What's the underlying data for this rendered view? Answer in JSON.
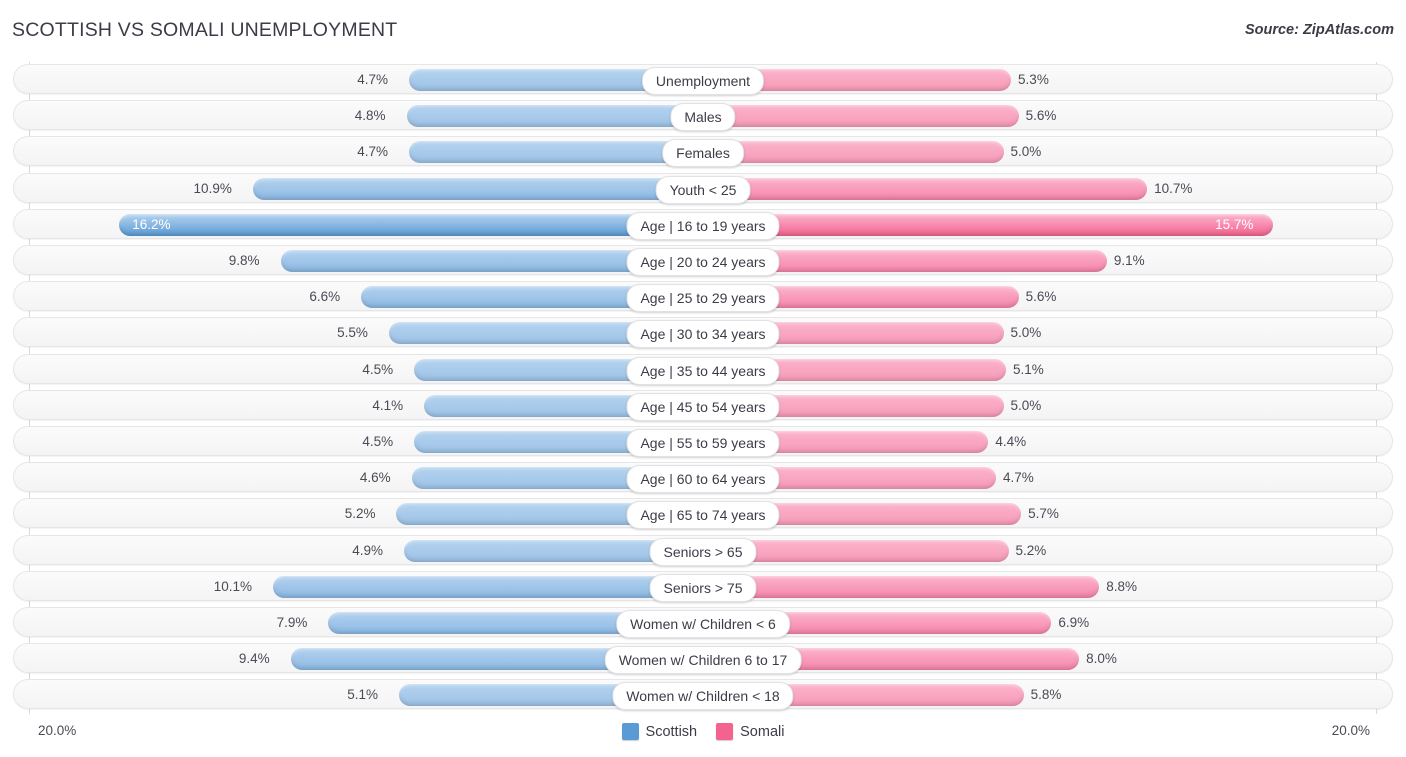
{
  "header": {
    "title": "SCOTTISH VS SOMALI UNEMPLOYMENT",
    "source": "Source: ZipAtlas.com"
  },
  "footer": {
    "axis_max_left": "20.0%",
    "axis_max_right": "20.0%",
    "legend": [
      {
        "label": "Scottish",
        "color": "#5b9bd5"
      },
      {
        "label": "Somali",
        "color": "#f4628f"
      }
    ]
  },
  "colors": {
    "scottish_light": "#9dc3e8",
    "scottish_mid": "#8cb9e4",
    "scottish_dark": "#5b9bd5",
    "somali_light": "#f79ab8",
    "somali_mid": "#f685ab",
    "somali_dark": "#f4628f",
    "row_background": "#f7f7f8",
    "text": "#3c3c48"
  },
  "chart_data": {
    "type": "bar",
    "orientation": "horizontal-diverging",
    "title": "SCOTTISH VS SOMALI UNEMPLOYMENT",
    "subtitle": "Source: ZipAtlas.com",
    "xlabel": "",
    "ylabel": "",
    "xlim": [
      20.0,
      20.0
    ],
    "axis_max_label": "20.0%",
    "grid": false,
    "legend_position": "bottom-center",
    "categories": [
      "Unemployment",
      "Males",
      "Females",
      "Youth < 25",
      "Age | 16 to 19 years",
      "Age | 20 to 24 years",
      "Age | 25 to 29 years",
      "Age | 30 to 34 years",
      "Age | 35 to 44 years",
      "Age | 45 to 54 years",
      "Age | 55 to 59 years",
      "Age | 60 to 64 years",
      "Age | 65 to 74 years",
      "Seniors > 65",
      "Seniors > 75",
      "Women w/ Children < 6",
      "Women w/ Children 6 to 17",
      "Women w/ Children < 18"
    ],
    "series": [
      {
        "name": "Scottish",
        "side": "left",
        "color": "#5b9bd5",
        "values": [
          4.7,
          4.8,
          4.7,
          10.9,
          16.2,
          9.8,
          6.6,
          5.5,
          4.5,
          4.1,
          4.5,
          4.6,
          5.2,
          4.9,
          10.1,
          7.9,
          9.4,
          5.1
        ],
        "labels": [
          "4.7%",
          "4.8%",
          "4.7%",
          "10.9%",
          "16.2%",
          "9.8%",
          "6.6%",
          "5.5%",
          "4.5%",
          "4.1%",
          "4.5%",
          "4.6%",
          "5.2%",
          "4.9%",
          "10.1%",
          "7.9%",
          "9.4%",
          "5.1%"
        ]
      },
      {
        "name": "Somali",
        "side": "right",
        "color": "#f4628f",
        "values": [
          5.3,
          5.6,
          5.0,
          10.7,
          15.7,
          9.1,
          5.6,
          5.0,
          5.1,
          5.0,
          4.4,
          4.7,
          5.7,
          5.2,
          8.8,
          6.9,
          8.0,
          5.8
        ],
        "labels": [
          "5.3%",
          "5.6%",
          "5.0%",
          "10.7%",
          "15.7%",
          "9.1%",
          "5.6%",
          "5.0%",
          "5.1%",
          "5.0%",
          "4.4%",
          "4.7%",
          "5.7%",
          "5.2%",
          "8.8%",
          "6.9%",
          "8.0%",
          "5.8%"
        ]
      }
    ]
  },
  "rows": [
    {
      "label": "Unemployment",
      "left": "4.7%",
      "right": "5.3%",
      "lv": 4.7,
      "rv": 5.3,
      "intensity": 0
    },
    {
      "label": "Males",
      "left": "4.8%",
      "right": "5.6%",
      "lv": 4.8,
      "rv": 5.6,
      "intensity": 0
    },
    {
      "label": "Females",
      "left": "4.7%",
      "right": "5.0%",
      "lv": 4.7,
      "rv": 5.0,
      "intensity": 0
    },
    {
      "label": "Youth < 25",
      "left": "10.9%",
      "right": "10.7%",
      "lv": 10.9,
      "rv": 10.7,
      "intensity": 1
    },
    {
      "label": "Age | 16 to 19 years",
      "left": "16.2%",
      "right": "15.7%",
      "lv": 16.2,
      "rv": 15.7,
      "intensity": 2
    },
    {
      "label": "Age | 20 to 24 years",
      "left": "9.8%",
      "right": "9.1%",
      "lv": 9.8,
      "rv": 9.1,
      "intensity": 1
    },
    {
      "label": "Age | 25 to 29 years",
      "left": "6.6%",
      "right": "5.6%",
      "lv": 6.6,
      "rv": 5.6,
      "intensity": 1
    },
    {
      "label": "Age | 30 to 34 years",
      "left": "5.5%",
      "right": "5.0%",
      "lv": 5.5,
      "rv": 5.0,
      "intensity": 0
    },
    {
      "label": "Age | 35 to 44 years",
      "left": "4.5%",
      "right": "5.1%",
      "lv": 4.5,
      "rv": 5.1,
      "intensity": 0
    },
    {
      "label": "Age | 45 to 54 years",
      "left": "4.1%",
      "right": "5.0%",
      "lv": 4.1,
      "rv": 5.0,
      "intensity": 0
    },
    {
      "label": "Age | 55 to 59 years",
      "left": "4.5%",
      "right": "4.4%",
      "lv": 4.5,
      "rv": 4.4,
      "intensity": 0
    },
    {
      "label": "Age | 60 to 64 years",
      "left": "4.6%",
      "right": "4.7%",
      "lv": 4.6,
      "rv": 4.7,
      "intensity": 0
    },
    {
      "label": "Age | 65 to 74 years",
      "left": "5.2%",
      "right": "5.7%",
      "lv": 5.2,
      "rv": 5.7,
      "intensity": 0
    },
    {
      "label": "Seniors > 65",
      "left": "4.9%",
      "right": "5.2%",
      "lv": 4.9,
      "rv": 5.2,
      "intensity": 0
    },
    {
      "label": "Seniors > 75",
      "left": "10.1%",
      "right": "8.8%",
      "lv": 10.1,
      "rv": 8.8,
      "intensity": 1
    },
    {
      "label": "Women w/ Children < 6",
      "left": "7.9%",
      "right": "6.9%",
      "lv": 7.9,
      "rv": 6.9,
      "intensity": 1
    },
    {
      "label": "Women w/ Children 6 to 17",
      "left": "9.4%",
      "right": "8.0%",
      "lv": 9.4,
      "rv": 8.0,
      "intensity": 1
    },
    {
      "label": "Women w/ Children < 18",
      "left": "5.1%",
      "right": "5.8%",
      "lv": 5.1,
      "rv": 5.8,
      "intensity": 0
    }
  ]
}
